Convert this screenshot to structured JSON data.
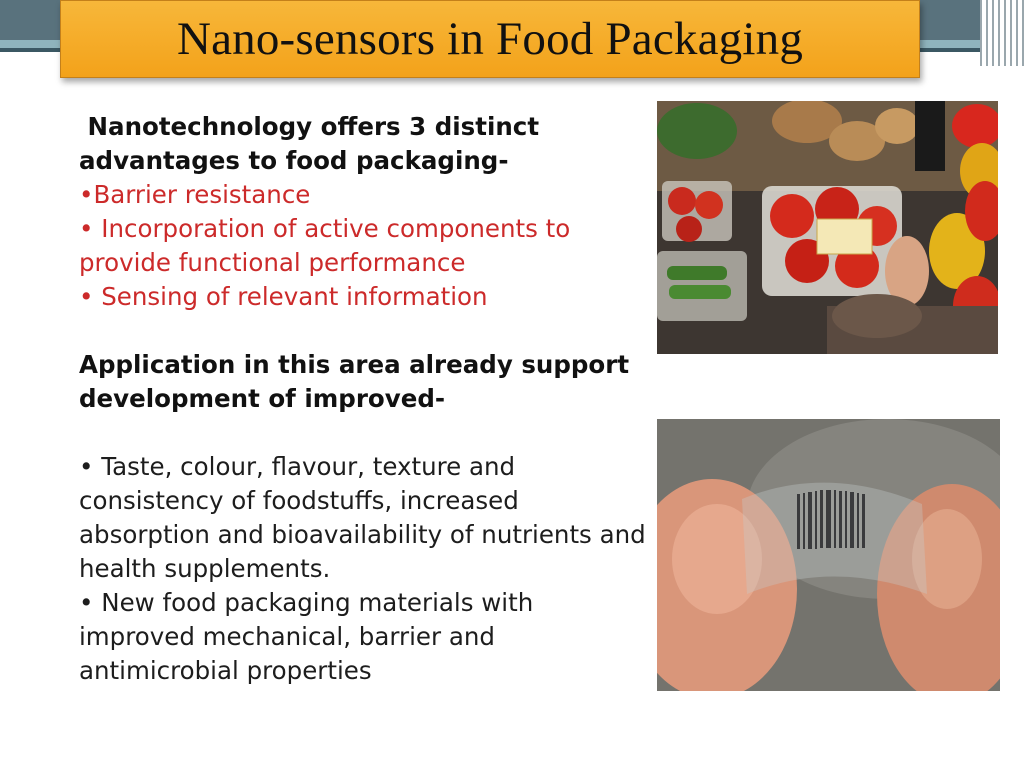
{
  "slide": {
    "title": "Nano-sensors in Food Packaging",
    "intro_line1": " Nanotechnology offers 3 distinct",
    "intro_line2": "advantages to food packaging-",
    "advantages": [
      "•Barrier resistance",
      "• Incorporation of active components to provide functional performance",
      "• Sensing of relevant information"
    ],
    "application_heading": "Application in this area already support development of improved-",
    "improvements": [
      "• Taste, colour, flavour, texture and consistency of foodstuffs, increased absorption and bioavailability of nutrients and health supplements.",
      "• New food packaging materials with improved mechanical, barrier and antimicrobial properties"
    ]
  },
  "colors": {
    "title_fill": "#f5ab28",
    "accent_red": "#cc2a2a",
    "band_teal": "#59727d"
  }
}
